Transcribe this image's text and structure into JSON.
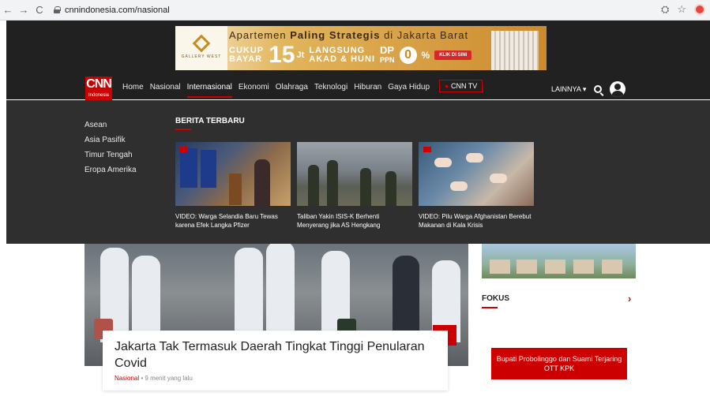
{
  "browser": {
    "back": "←",
    "forward": "→",
    "reload": "C",
    "url": "cnnindonesia.com/nasional",
    "translate": "⛭",
    "star": "☆"
  },
  "banner": {
    "logo_text": "GALLERY WEST",
    "title_pre": "Apartemen ",
    "title_bold": "Paling Strategis",
    "title_post": " di Jakarta Barat",
    "cukup": "CUKUP",
    "bayar": "BAYAR",
    "amount": "15",
    "unit": "Jt",
    "langsung": "LANGSUNG",
    "akad": "AKAD & HUNI",
    "dp": "DP",
    "ppn": "PPN",
    "zero": "0",
    "pct": "%",
    "cta": "KLIK DI SINI"
  },
  "logo": {
    "cnn": "CNN",
    "sub": "Indonesia"
  },
  "nav": {
    "items": [
      "Home",
      "Nasional",
      "Internasional",
      "Ekonomi",
      "Olahraga",
      "Teknologi",
      "Hiburan",
      "Gaya Hidup"
    ],
    "cnntv": "CNN TV",
    "cnntv_dot": "●",
    "lainnya": "LAINNYA ▾"
  },
  "dropdown": {
    "links": [
      "Asean",
      "Asia Pasifik",
      "Timur Tengah",
      "Eropa Amerika"
    ],
    "heading": "BERITA TERBARU",
    "cards": [
      {
        "title": "VIDEO: Warga Selandia Baru Tewas karena Efek Langka Pfizer"
      },
      {
        "title": "Taliban Yakin ISIS-K Berhenti Menyerang jika AS Hengkang"
      },
      {
        "title": "VIDEO: Pilu Warga Afghanistan Berebut Makanan di Kala Krisis"
      }
    ]
  },
  "hero": {
    "title": "Jakarta Tak Termasuk Daerah Tingkat Tinggi Penularan Covid",
    "category": "Nasional",
    "sep": " • ",
    "time": "9 menit yang lalu"
  },
  "side": {
    "fokus": "FOKUS",
    "arrow": "›",
    "button": "Bupati Probolinggo dan Suami Terjaring OTT KPK"
  }
}
